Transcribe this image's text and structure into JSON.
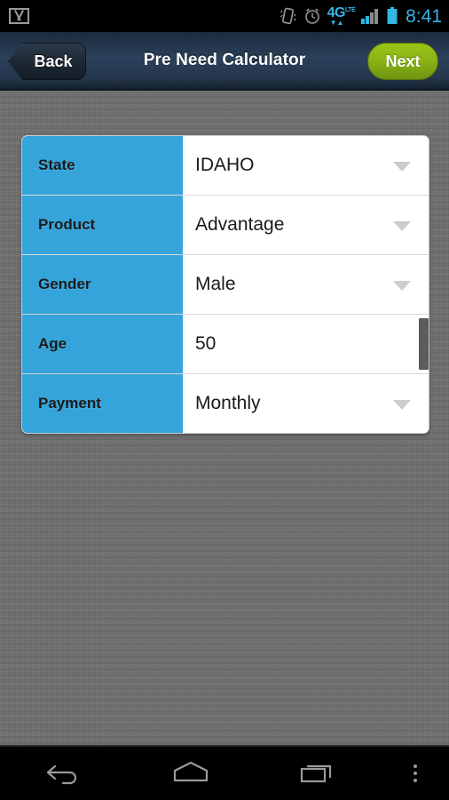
{
  "status_bar": {
    "notification_icon": "gmail-icon",
    "icons": [
      "vibrate-icon",
      "alarm-clock-icon",
      "4g-lte-icon",
      "signal-bars-icon",
      "battery-icon"
    ],
    "network_label": "4G",
    "network_sup": "LTE",
    "time": "8:41"
  },
  "action_bar": {
    "back_label": "Back",
    "title": "Pre Need Calculator",
    "next_label": "Next",
    "accent_green": "#8ab315",
    "bar_color": "#2b405a"
  },
  "form": {
    "accent_blue": "#35a4db",
    "rows": [
      {
        "label": "State",
        "value": "IDAHO",
        "control": "dropdown"
      },
      {
        "label": "Product",
        "value": "Advantage",
        "control": "dropdown"
      },
      {
        "label": "Gender",
        "value": "Male",
        "control": "dropdown"
      },
      {
        "label": "Age",
        "value": "50",
        "control": "scroll"
      },
      {
        "label": "Payment",
        "value": "Monthly",
        "control": "dropdown"
      }
    ]
  },
  "nav_bar": {
    "buttons": [
      "back-nav-icon",
      "home-nav-icon",
      "recent-apps-nav-icon",
      "overflow-menu-icon"
    ]
  }
}
